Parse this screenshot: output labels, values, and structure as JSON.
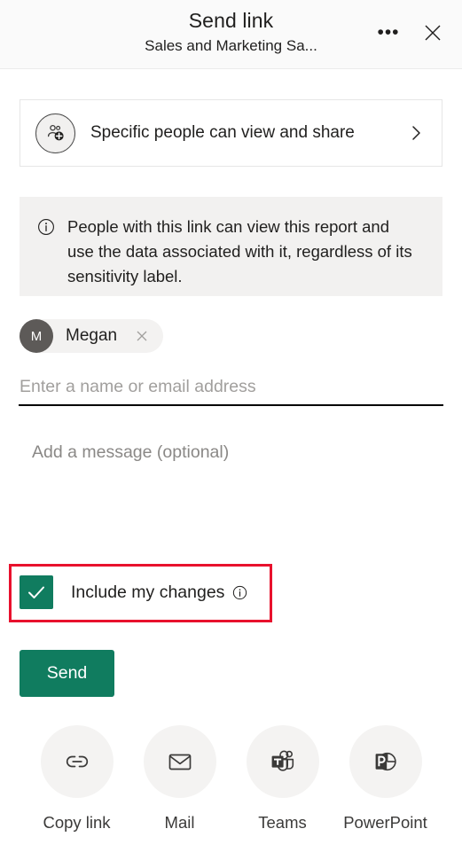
{
  "header": {
    "title": "Send link",
    "subtitle": "Sales and Marketing Sa...",
    "more_label": "•••",
    "more_icon": "ellipsis-icon",
    "close_icon": "close-icon"
  },
  "permission": {
    "icon": "people-add-icon",
    "label": "Specific people can view and share",
    "chevron_icon": "chevron-right-icon"
  },
  "info_banner": {
    "icon": "info-circle-icon",
    "text": "People with this link can view this report and use the data associated with it, regardless of its sensitivity label."
  },
  "recipients": {
    "chips": [
      {
        "initial": "M",
        "name": "Megan",
        "remove_icon": "close-icon"
      }
    ],
    "input_value": "",
    "input_placeholder": "Enter a name or email address"
  },
  "message": {
    "value": "",
    "placeholder": "Add a message (optional)"
  },
  "include_changes": {
    "label": "Include my changes",
    "checked": true,
    "check_icon": "checkmark-icon",
    "info_icon": "info-circle-icon",
    "highlight_color": "#e8112d"
  },
  "send": {
    "label": "Send"
  },
  "actions": [
    {
      "label": "Copy link",
      "icon": "link-icon"
    },
    {
      "label": "Mail",
      "icon": "mail-envelope-icon"
    },
    {
      "label": "Teams",
      "icon": "microsoft-teams-icon"
    },
    {
      "label": "PowerPoint",
      "icon": "microsoft-powerpoint-icon"
    }
  ],
  "colors": {
    "accent_green": "#107c5f",
    "highlight_red": "#e8112d",
    "banner_bg": "#f2f1f0",
    "chip_bg": "#f3f2f1",
    "avatar_bg": "#5d5a58"
  }
}
